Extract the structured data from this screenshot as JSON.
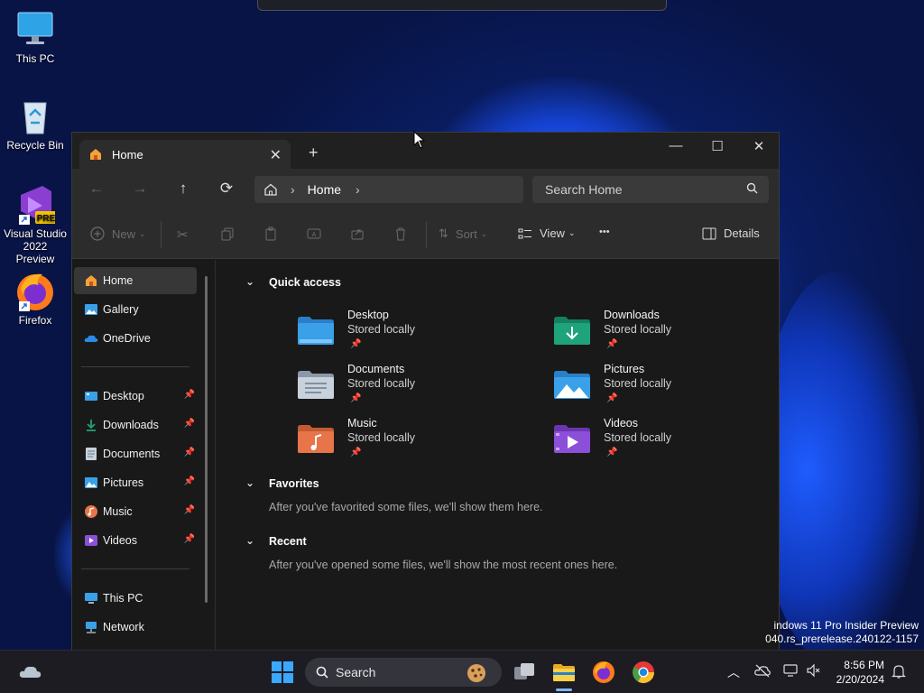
{
  "desktop": {
    "icons": [
      {
        "label": "This PC"
      },
      {
        "label": "Recycle Bin"
      },
      {
        "label": "Visual Studio 2022 Preview"
      },
      {
        "label": "Firefox"
      }
    ]
  },
  "explorer": {
    "tab_title": "Home",
    "tab_close": "✕",
    "new_tab": "+",
    "minimize": "—",
    "maximize": "☐",
    "close": "✕",
    "nav": {
      "back": "←",
      "forward": "→",
      "up": "↑",
      "refresh": "⟳"
    },
    "address": {
      "location": "Home",
      "sep": "›"
    },
    "search_placeholder": "Search Home",
    "commands": {
      "new": "New",
      "sort": "Sort",
      "view": "View",
      "more": "•••",
      "details": "Details"
    },
    "sidebar": {
      "top": [
        {
          "label": "Home"
        },
        {
          "label": "Gallery"
        },
        {
          "label": "OneDrive"
        }
      ],
      "pinned": [
        {
          "label": "Desktop"
        },
        {
          "label": "Downloads"
        },
        {
          "label": "Documents"
        },
        {
          "label": "Pictures"
        },
        {
          "label": "Music"
        },
        {
          "label": "Videos"
        }
      ],
      "bottom": [
        {
          "label": "This PC"
        },
        {
          "label": "Network"
        }
      ]
    },
    "quick_access": {
      "title": "Quick access",
      "items": [
        {
          "name": "Desktop",
          "status": "Stored locally"
        },
        {
          "name": "Downloads",
          "status": "Stored locally"
        },
        {
          "name": "Documents",
          "status": "Stored locally"
        },
        {
          "name": "Pictures",
          "status": "Stored locally"
        },
        {
          "name": "Music",
          "status": "Stored locally"
        },
        {
          "name": "Videos",
          "status": "Stored locally"
        }
      ]
    },
    "favorites": {
      "title": "Favorites",
      "note": "After you've favorited some files, we'll show them here."
    },
    "recent": {
      "title": "Recent",
      "note": "After you've opened some files, we'll show the most recent ones here."
    }
  },
  "watermark": {
    "line1": "indows 11 Pro Insider Preview",
    "line2": "040.rs_prerelease.240122-1157"
  },
  "taskbar": {
    "search_label": "Search",
    "time": "8:56 PM",
    "date": "2/20/2024"
  },
  "colors": {
    "folder_blue": "#3aa0e8",
    "downloads_green": "#1fa37a",
    "music_orange": "#e8744a",
    "videos_purple": "#8b4fd8",
    "window_bg": "#191919"
  }
}
